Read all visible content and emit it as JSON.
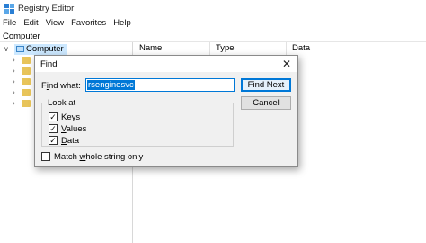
{
  "window": {
    "title": "Registry Editor"
  },
  "menu": [
    "File",
    "Edit",
    "View",
    "Favorites",
    "Help"
  ],
  "address": "Computer",
  "tree": {
    "root_label": "Computer",
    "child_count": 5
  },
  "columns": [
    "Name",
    "Type",
    "Data"
  ],
  "find_dialog": {
    "title": "Find",
    "find_what_label_accel": "i",
    "find_what_label_pre": "F",
    "find_what_label_post": "nd what:",
    "find_what_value": "rsenginesvc",
    "find_next_label": "Find Next",
    "cancel_label": "Cancel",
    "look_at_label": "Look at",
    "checkboxes": [
      {
        "label_pre": "",
        "label_accel": "K",
        "label_post": "eys",
        "checked": true
      },
      {
        "label_pre": "",
        "label_accel": "V",
        "label_post": "alues",
        "checked": true
      },
      {
        "label_pre": "",
        "label_accel": "D",
        "label_post": "ata",
        "checked": true
      }
    ],
    "match_whole": {
      "label_pre": "Match ",
      "label_accel": "w",
      "label_post": "hole string only",
      "checked": false
    }
  },
  "colors": {
    "accent": "#0078d7",
    "selection": "#cce8ff"
  },
  "icons": {
    "app": "registry-editor-icon",
    "root": "computer-icon",
    "folder": "folder-icon",
    "close": "close-icon"
  }
}
